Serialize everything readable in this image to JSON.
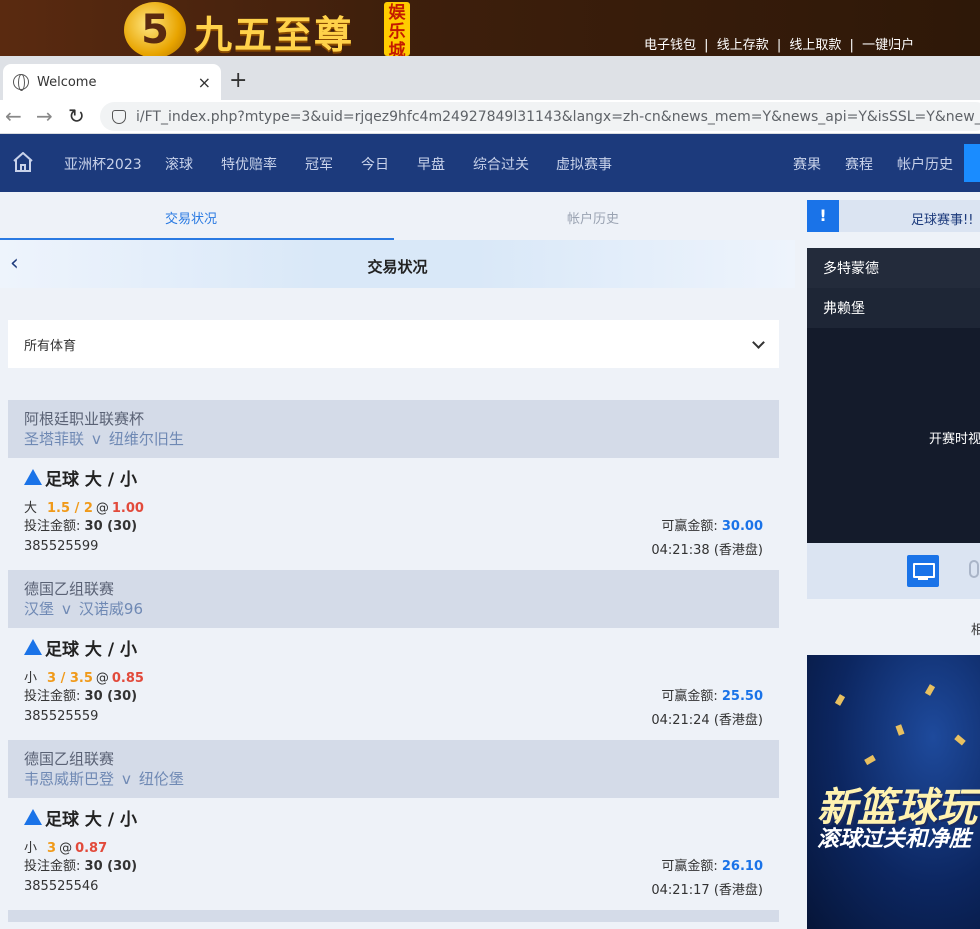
{
  "banner": {
    "logo_digit": "5",
    "logo_text": "九五至尊",
    "logo_badge": "娱乐城",
    "links": [
      "电子钱包",
      "线上存款",
      "线上取款",
      "一键归户"
    ],
    "separator": "|"
  },
  "browser": {
    "tab_title": "Welcome",
    "close_glyph": "×",
    "newtab_glyph": "+",
    "url": "i/FT_index.php?mtype=3&uid=rjqez9hfc4m24927849l31143&langx=zh-cn&news_mem=Y&news_api=Y&isSSL=Y&new_site=Y"
  },
  "sitenav": {
    "left_items": [
      "亚洲杯2023",
      "滚球",
      "特优赔率",
      "冠军",
      "今日",
      "早盘",
      "综合过关",
      "虚拟赛事"
    ],
    "right_items": [
      "赛果",
      "赛程",
      "帐户历史"
    ]
  },
  "subtabs": {
    "active": "交易状况",
    "inactive": "帐户历史"
  },
  "page_title": "交易状况",
  "sport_filter": {
    "selected": "所有体育"
  },
  "labels": {
    "stake": "投注金额:",
    "win": "可赢金额:",
    "vs": "v",
    "at": "@",
    "odds_type": "(香港盘)"
  },
  "bets": [
    {
      "league": "阿根廷职业联赛杯",
      "home": "圣塔菲联",
      "away": "纽维尔旧生",
      "market": "足球 大 / 小",
      "side": "大",
      "line": "1.5 / 2",
      "odds": "1.00",
      "stake": "30 (30)",
      "win": "30.00",
      "ticket": "385525599",
      "time": "04:21:38"
    },
    {
      "league": "德国乙组联赛",
      "home": "汉堡",
      "away": "汉诺威96",
      "market": "足球 大 / 小",
      "side": "小",
      "line": "3 / 3.5",
      "odds": "0.85",
      "stake": "30 (30)",
      "win": "25.50",
      "ticket": "385525559",
      "time": "04:21:24"
    },
    {
      "league": "德国乙组联赛",
      "home": "韦恩威斯巴登",
      "away": "纽伦堡",
      "market": "足球 大 / 小",
      "side": "小",
      "line": "3",
      "odds": "0.87",
      "stake": "30 (30)",
      "win": "26.10",
      "ticket": "385525546",
      "time": "04:21:17"
    }
  ],
  "right_panel": {
    "header": "足球赛事!!",
    "msg_icon_glyph": "!",
    "team1": "多特蒙德",
    "team2": "弗赖堡",
    "video_msg": "开赛时视",
    "small_text": "相",
    "promo_title": "新篮球玩",
    "promo_sub": "滚球过关和净胜"
  },
  "colors": {
    "nav_bg": "#1c3a7c",
    "accent": "#2a7ae2",
    "line_color": "#f09a1a",
    "odds_color": "#e24a3b",
    "win_color": "#1a73e8"
  }
}
